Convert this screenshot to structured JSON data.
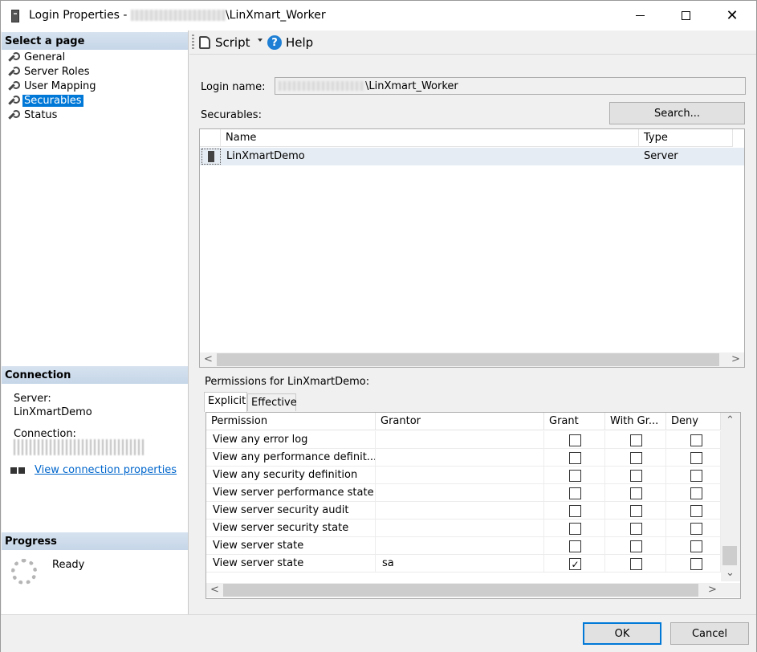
{
  "window": {
    "title_prefix": "Login Properties - ",
    "title_suffix": "\\LinXmart_Worker"
  },
  "left": {
    "select_page_header": "Select a page",
    "pages": [
      "General",
      "Server Roles",
      "User Mapping",
      "Securables",
      "Status"
    ],
    "selected_page": "Securables",
    "connection_header": "Connection",
    "server_label": "Server:",
    "server_value": "LinXmartDemo",
    "connection_label": "Connection:",
    "view_connection_link": "View connection properties",
    "progress_header": "Progress",
    "progress_status": "Ready"
  },
  "toolbar": {
    "script_label": "Script",
    "help_label": "Help"
  },
  "main": {
    "login_name_label": "Login name:",
    "login_name_value": "\\LinXmart_Worker",
    "securables_label": "Securables:",
    "search_button": "Search...",
    "securables_columns": [
      "Name",
      "Type"
    ],
    "securables_rows": [
      {
        "name": "LinXmartDemo",
        "type": "Server"
      }
    ],
    "permissions_label": "Permissions for LinXmartDemo:",
    "tabs": [
      "Explicit",
      "Effective"
    ],
    "active_tab": "Explicit",
    "permission_columns": [
      "Permission",
      "Grantor",
      "Grant",
      "With Gr...",
      "Deny"
    ],
    "permissions": [
      {
        "permission": "View any error log",
        "grantor": "",
        "grant": false,
        "with_grant": false,
        "deny": false
      },
      {
        "permission": "View any performance definit...",
        "grantor": "",
        "grant": false,
        "with_grant": false,
        "deny": false
      },
      {
        "permission": "View any security definition",
        "grantor": "",
        "grant": false,
        "with_grant": false,
        "deny": false
      },
      {
        "permission": "View server performance state",
        "grantor": "",
        "grant": false,
        "with_grant": false,
        "deny": false
      },
      {
        "permission": "View server security audit",
        "grantor": "",
        "grant": false,
        "with_grant": false,
        "deny": false
      },
      {
        "permission": "View server security state",
        "grantor": "",
        "grant": false,
        "with_grant": false,
        "deny": false
      },
      {
        "permission": "View server state",
        "grantor": "",
        "grant": false,
        "with_grant": false,
        "deny": false
      },
      {
        "permission": "View server state",
        "grantor": "sa",
        "grant": true,
        "with_grant": false,
        "deny": false
      }
    ]
  },
  "footer": {
    "ok_button": "OK",
    "cancel_button": "Cancel"
  },
  "colors": {
    "selection": "#0078d7",
    "link": "#0066cc",
    "section_header": "#c6d6e8",
    "row_highlight": "#e6ecf3"
  }
}
